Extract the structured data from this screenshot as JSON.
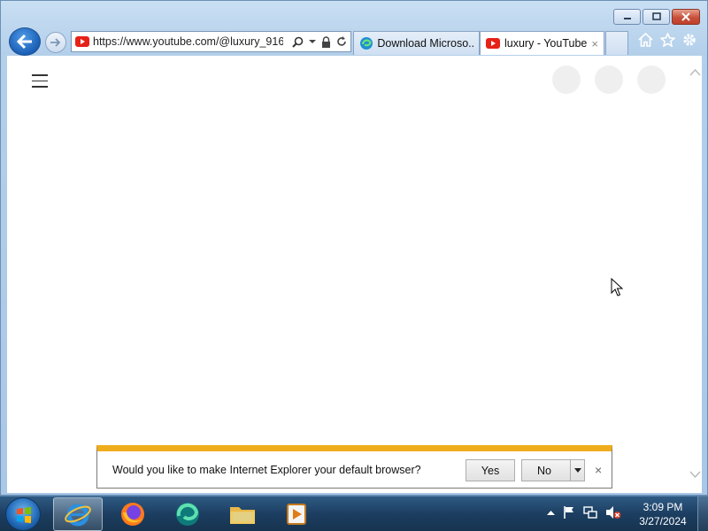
{
  "window": {
    "caption_buttons": [
      "minimize-icon",
      "restore-icon",
      "close-icon"
    ]
  },
  "address_bar": {
    "url": "https://www.youtube.com/@luxury_916"
  },
  "tabs": [
    {
      "label": "Download Microso...",
      "icon": "edge-icon"
    },
    {
      "label": "luxury - YouTube",
      "icon": "youtube-icon",
      "active": true,
      "close": "×"
    }
  ],
  "toolbar": {
    "icons": [
      "home-icon",
      "favorites-star-icon",
      "settings-gear-icon"
    ]
  },
  "notification": {
    "message": "Would you like to make Internet Explorer your default browser?",
    "yes_label": "Yes",
    "no_label": "No",
    "close": "×",
    "accent_color": "#efac1c"
  },
  "taskbar": {
    "apps": [
      "internet-explorer-icon",
      "firefox-icon",
      "edge-beta-icon",
      "file-explorer-icon",
      "media-player-icon"
    ],
    "time": "3:09 PM",
    "date": "3/27/2024"
  }
}
